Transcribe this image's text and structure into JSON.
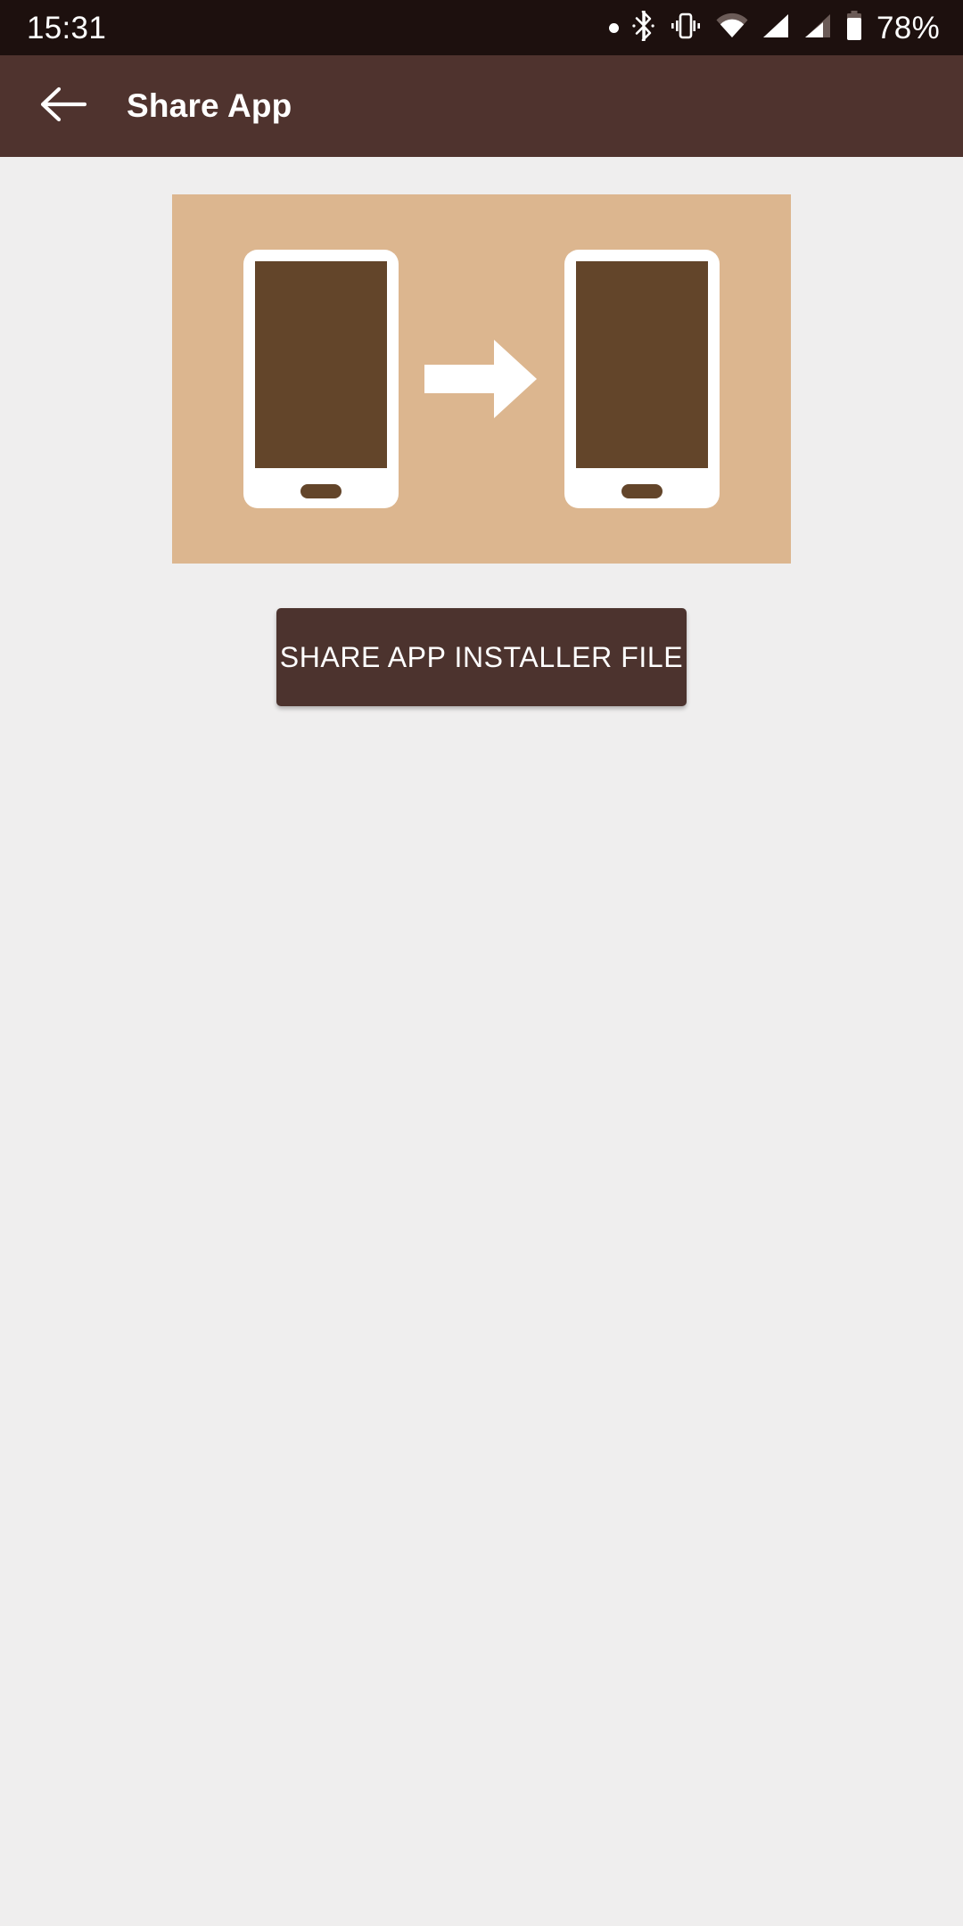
{
  "status_bar": {
    "time": "15:31",
    "battery_percent": "78%",
    "icons": [
      "dot-icon",
      "bluetooth-icon",
      "vibrate-icon",
      "wifi-icon",
      "signal-full-icon",
      "signal-partial-icon",
      "battery-icon"
    ],
    "background_color": "#1d100e",
    "foreground_color": "#ffffff"
  },
  "app_bar": {
    "title": "Share App",
    "back_icon": "arrow-left-icon",
    "background_color": "#4f332e",
    "title_color": "#ffffff"
  },
  "main": {
    "hero": {
      "background_color": "#dcb68f",
      "left_phone_icon": "phone-icon",
      "arrow_icon": "arrow-right-icon",
      "right_phone_icon": "phone-icon",
      "phone_body_color": "#ffffff",
      "phone_screen_color": "#63452a"
    },
    "share_button": {
      "label": "SHARE APP INSTALLER FILE",
      "background_color": "#4c332e",
      "text_color": "#ffffff"
    },
    "background_color": "#efeeee"
  }
}
